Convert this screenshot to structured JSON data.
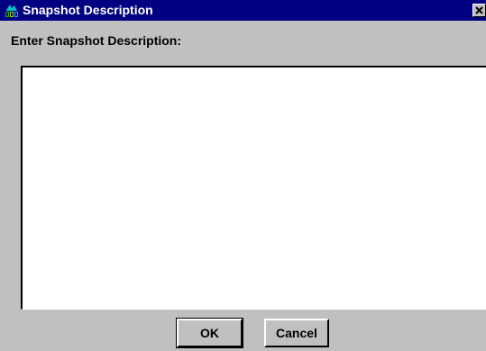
{
  "window": {
    "title": "Snapshot Description",
    "icon": "app-icon",
    "close_icon": "close-icon"
  },
  "form": {
    "prompt_label": "Enter Snapshot Description:",
    "description_value": ""
  },
  "buttons": {
    "ok_label": "OK",
    "cancel_label": "Cancel"
  },
  "colors": {
    "titlebar": "#000080",
    "window_bg": "#c0c0c0",
    "field_bg": "#ffffff"
  }
}
